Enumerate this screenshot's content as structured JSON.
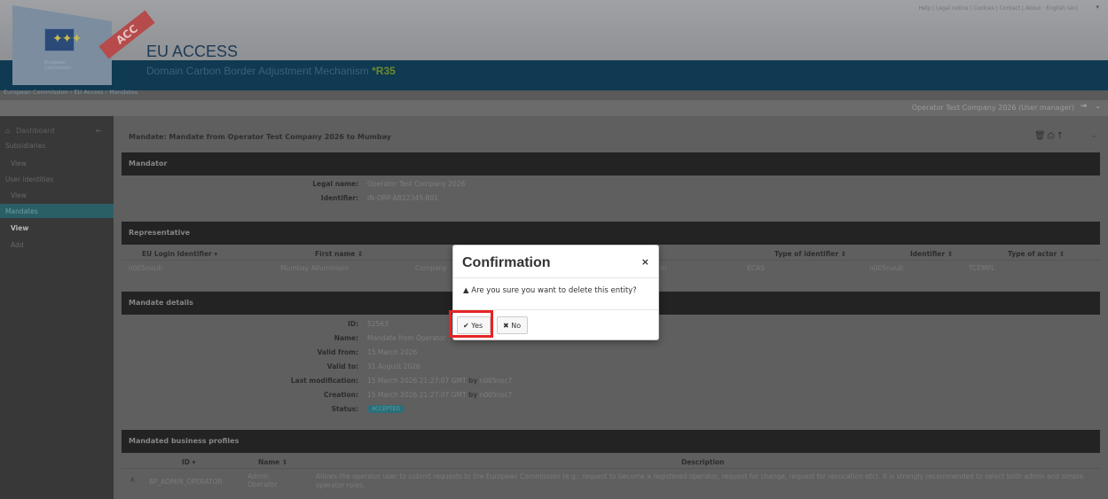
{
  "header": {
    "title": "EU ACCESS",
    "subtitle": "Domain Carbon Border Adjustment Mechanism",
    "release": "*R35",
    "logo_caption": "European Commission",
    "ribbon": "ACC",
    "top_links": "Help | Legal notice | Cookies | Contact | About · English (en)",
    "breadcrumb": "European Commission › EU Access › Mandates"
  },
  "userbar": {
    "user_label": "Operator Test Company 2026 (User manager)"
  },
  "sidebar": {
    "home_label": "Dashboard",
    "items": [
      {
        "label": "Subsidiaries"
      },
      {
        "label": "View"
      },
      {
        "label": "User identities"
      },
      {
        "label": "View"
      },
      {
        "label": "Mandates"
      },
      {
        "label": "View"
      },
      {
        "label": "Add"
      }
    ]
  },
  "page": {
    "title": "Mandate: Mandate from Operator Test Company 2026 to Mumbay"
  },
  "mandator": {
    "heading": "Mandator",
    "legal_name_label": "Legal name:",
    "legal_name": "Operator Test Company 2026",
    "identifier_label": "Identifier:",
    "identifier": "IN-ORP-AB12345-B01"
  },
  "representative": {
    "heading": "Representative",
    "columns": [
      "EU Login Identifier ▾",
      "First name ⇕",
      "Type of identifier ⇕",
      "Identifier ⇕",
      "Type of actor ⇕"
    ],
    "row": {
      "login": "n005nuub",
      "first_name": "Mumbay Alluminium",
      "company_partial": "Company",
      "partial": "m",
      "type_identifier": "ECAS",
      "identifier": "n005nuub",
      "type_actor": "TCEMPL"
    }
  },
  "mandate_details": {
    "heading": "Mandate details",
    "rows": [
      {
        "label": "ID:",
        "value": "52563"
      },
      {
        "label": "Name:",
        "value": "Mandate from Operator"
      },
      {
        "label": "Valid from:",
        "value": "15 March 2026"
      },
      {
        "label": "Valid to:",
        "value": "31 August 2026"
      },
      {
        "label": "Last modification:",
        "value": "15 March 2026 21:27:07 GMT",
        "by": "by",
        "user": "n005nsc7"
      },
      {
        "label": "Creation:",
        "value": "15 March 2026 21:27:07 GMT",
        "by": "by",
        "user": "n005nsc7"
      },
      {
        "label": "Status:",
        "badge": "ACCEPTED"
      }
    ]
  },
  "profiles": {
    "heading": "Mandated business profiles",
    "columns": [
      "ID ▾",
      "Name ⇕",
      "Description"
    ],
    "row": {
      "id": "BP_ADMIN_OPERATOR",
      "name": "Admin Operator",
      "description": "Allows the operator user to submit requests to the European Commission (e.g.: request to become a registered operator, request for change, request for revocation etc). It is strongly recommended to select both admin and simple operator roles."
    }
  },
  "dialog": {
    "title": "Confirmation",
    "close": "×",
    "message": "Are you sure you want to delete this entity?",
    "yes_label": "Yes",
    "no_label": "No"
  },
  "icons": {
    "warning": "warning-icon",
    "check": "check-icon",
    "times": "times-icon",
    "home": "home-icon",
    "trash": "trash-icon",
    "print": "print-icon",
    "arrow_up": "arrow-up-icon",
    "logout": "logout-icon"
  },
  "colors": {
    "highlight": "#e52424",
    "header_band": "#0f3a52",
    "status_badge": "#2b6f78"
  }
}
